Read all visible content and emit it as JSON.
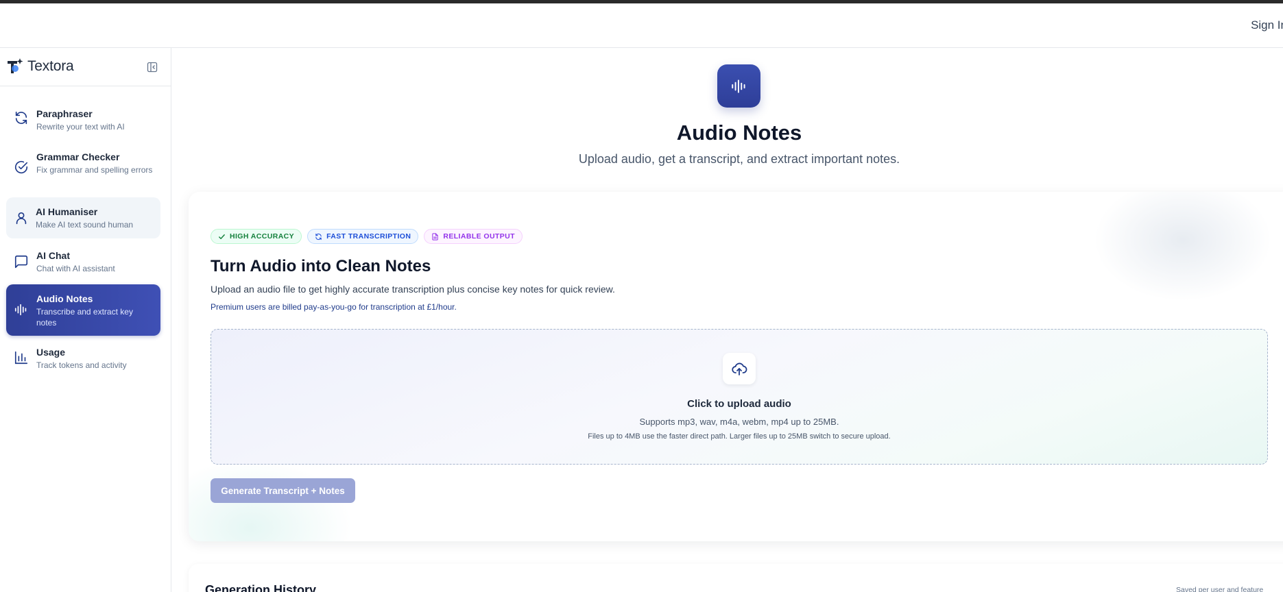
{
  "header": {
    "signin_label": "Sign In"
  },
  "brand": {
    "name": "Textora"
  },
  "sidebar": {
    "items": [
      {
        "title": "Paraphraser",
        "desc": "Rewrite your text with AI",
        "icon": "refresh-icon"
      },
      {
        "title": "Grammar Checker",
        "desc": "Fix grammar and spelling errors",
        "icon": "check-circle-icon"
      },
      {
        "title": "AI Humaniser",
        "desc": "Make AI text sound human",
        "icon": "user-icon"
      },
      {
        "title": "AI Chat",
        "desc": "Chat with AI assistant",
        "icon": "chat-icon"
      },
      {
        "title": "Audio Notes",
        "desc": "Transcribe and extract key notes",
        "icon": "audio-wave-icon"
      },
      {
        "title": "Usage",
        "desc": "Track tokens and activity",
        "icon": "bar-chart-icon"
      }
    ],
    "active_item": "Audio Notes",
    "hovered_item": "AI Humaniser"
  },
  "main": {
    "title": "Audio Notes",
    "subtitle": "Upload audio, get a transcript, and extract important notes."
  },
  "card": {
    "badges": [
      "HIGH ACCURACY",
      "FAST TRANSCRIPTION",
      "RELIABLE OUTPUT"
    ],
    "title": "Turn Audio into Clean Notes",
    "desc": "Upload an audio file to get highly accurate transcription plus concise key notes for quick review.",
    "note": "Premium users are billed pay-as-you-go for transcription at £1/hour.",
    "dropzone": {
      "title": "Click to upload audio",
      "sub": "Supports mp3, wav, m4a, webm, mp4 up to 25MB.",
      "note": "Files up to 4MB use the faster direct path. Larger files up to 25MB switch to secure upload."
    },
    "button_label": "Generate Transcript + Notes"
  },
  "history": {
    "title": "Generation History",
    "meta": "Saved per user and feature"
  },
  "colors": {
    "accent": "#3f50b5",
    "accent_dark": "#2f3f97",
    "button_disabled": "#9aa5d6"
  }
}
